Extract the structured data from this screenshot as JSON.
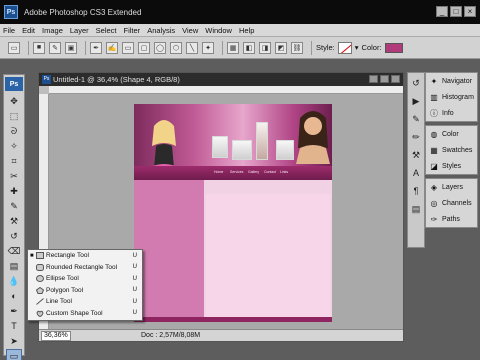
{
  "window": {
    "title": "Adobe Photoshop CS3 Extended",
    "app_badge": "Ps",
    "buttons": {
      "minimize": "_",
      "maximize": "□",
      "close": "×"
    }
  },
  "menu": [
    "File",
    "Edit",
    "Image",
    "Layer",
    "Select",
    "Filter",
    "Analysis",
    "View",
    "Window",
    "Help"
  ],
  "options_bar": {
    "style_label": "Style:",
    "color_label": "Color:",
    "color_value": "#b03a7a"
  },
  "toolbox": {
    "badge": "Ps"
  },
  "document": {
    "title": "Untitled-1 @ 36,4% (Shape 4, RGB/8)",
    "zoom": "36,36%",
    "doc_info": "Doc : 2,57M/8,08M",
    "nav_links": [
      "Home",
      "Services",
      "Gallery",
      "Contact",
      "Links"
    ]
  },
  "flyout": {
    "items": [
      {
        "label": "Rectangle Tool",
        "key": "U",
        "checked": true
      },
      {
        "label": "Rounded Rectangle Tool",
        "key": "U",
        "checked": false
      },
      {
        "label": "Ellipse Tool",
        "key": "U",
        "checked": false
      },
      {
        "label": "Polygon Tool",
        "key": "U",
        "checked": false
      },
      {
        "label": "Line Tool",
        "key": "U",
        "checked": false
      },
      {
        "label": "Custom Shape Tool",
        "key": "U",
        "checked": false
      }
    ]
  },
  "panels": {
    "group1": [
      "Navigator",
      "Histogram",
      "Info"
    ],
    "group2": [
      "Color",
      "Swatches",
      "Styles"
    ],
    "group3": [
      "Layers",
      "Channels",
      "Paths"
    ]
  },
  "colors": {
    "accent_pink": "#b03a7a",
    "dark_magenta": "#6e1c4c",
    "light_pink": "#f6d6e8"
  }
}
